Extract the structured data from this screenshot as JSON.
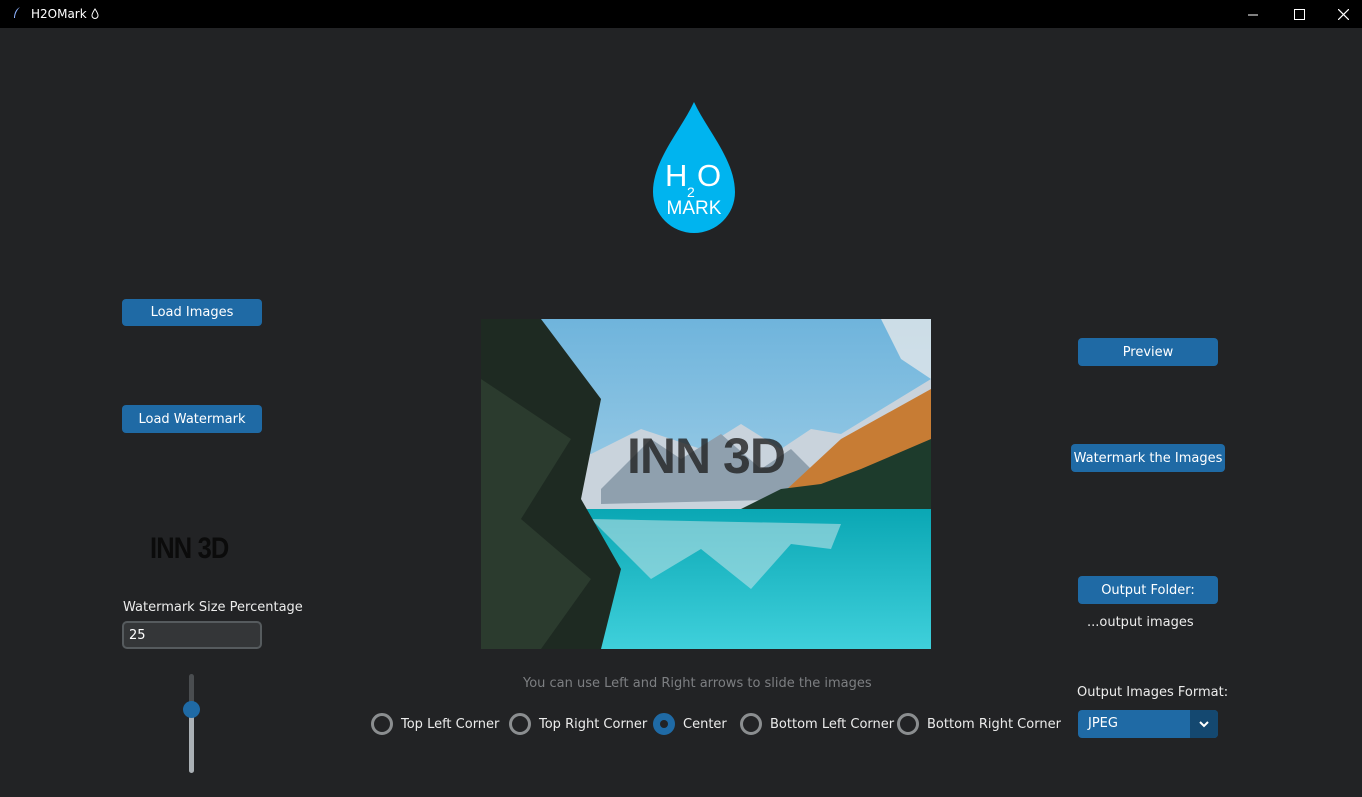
{
  "window": {
    "title": "H2OMark",
    "title_icon": "droplet-outline-icon",
    "controls": [
      "minimize-icon",
      "maximize-icon",
      "close-icon"
    ]
  },
  "logo": {
    "line1": "H",
    "subscript": "2",
    "line1_end": "O",
    "line2": "MARK",
    "color": "#00b4ef"
  },
  "buttons": {
    "load_images": "Load Images",
    "load_watermark": "Load Watermark",
    "preview": "Preview",
    "watermark_images": "Watermark the Images",
    "output_folder": "Output Folder:"
  },
  "watermark_thumbnail_text": "INN 3D",
  "size": {
    "label": "Watermark Size Percentage",
    "value": "25"
  },
  "preview": {
    "overlay_text": "INN 3D"
  },
  "hint": "You can use Left and Right arrows to slide the images",
  "positions": [
    {
      "label": "Top Left Corner",
      "checked": false
    },
    {
      "label": "Top Right Corner",
      "checked": false
    },
    {
      "label": "Center",
      "checked": true
    },
    {
      "label": "Bottom Left Corner",
      "checked": false
    },
    {
      "label": "Bottom Right Corner",
      "checked": false
    }
  ],
  "output_path": "...output images",
  "format": {
    "label": "Output Images Format:",
    "selected": "JPEG"
  },
  "colors": {
    "accent": "#1f6aa5",
    "background": "#222325",
    "titlebar": "#000000"
  }
}
